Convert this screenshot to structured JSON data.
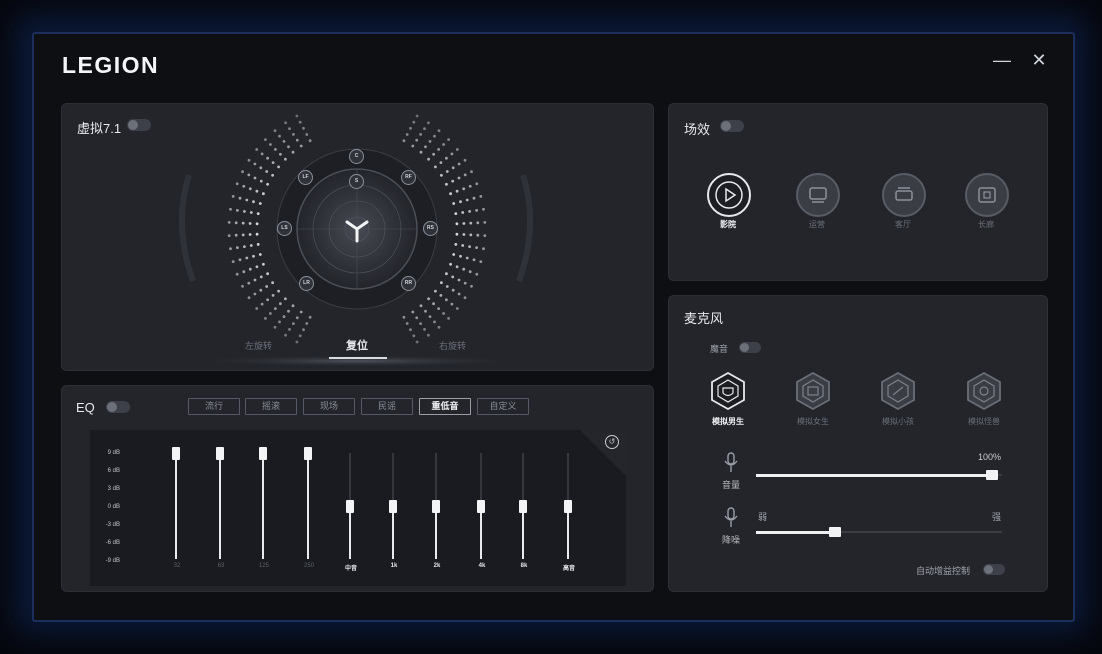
{
  "app": {
    "logo": "LEGION",
    "minimize": "—",
    "close": "✕"
  },
  "virtual71": {
    "title": "虚拟7.1",
    "speakers": [
      "C",
      "S",
      "LF",
      "RF",
      "LS",
      "RS",
      "LR",
      "RR"
    ],
    "controls": {
      "left": "左旋转",
      "center": "复位",
      "right": "右旋转"
    }
  },
  "scene": {
    "title": "场效",
    "modes": [
      {
        "label": "影院",
        "icon": "play-icon"
      },
      {
        "label": "运营",
        "icon": "theater-icon"
      },
      {
        "label": "客厅",
        "icon": "livingroom-icon"
      },
      {
        "label": "长廊",
        "icon": "corridor-icon"
      }
    ],
    "active_index": 0
  },
  "eq": {
    "title": "EQ",
    "presets": [
      "流行",
      "摇滚",
      "现场",
      "民谣",
      "重低音",
      "自定义"
    ],
    "active_preset": 4,
    "db_labels": [
      "9 dB",
      "6 dB",
      "3 dB",
      "0 dB",
      "-3 dB",
      "-6 dB",
      "-9 dB"
    ],
    "bands": [
      "32",
      "63",
      "125",
      "250",
      "中音",
      "1k",
      "2k",
      "4k",
      "8k",
      "高音"
    ],
    "band_values": [
      9,
      9,
      9,
      9,
      0,
      0,
      0,
      0,
      0,
      0
    ],
    "active_bands": [
      4,
      5,
      6,
      7,
      8,
      9
    ],
    "reset_icon": "reset-icon"
  },
  "mic": {
    "title": "麦克风",
    "voice_change_label": "魔音",
    "modes": [
      {
        "label": "模拟男生",
        "icon": "male-voice-icon"
      },
      {
        "label": "模拟女生",
        "icon": "female-voice-icon"
      },
      {
        "label": "模拟小孩",
        "icon": "child-voice-icon"
      },
      {
        "label": "模拟怪兽",
        "icon": "monster-voice-icon"
      }
    ],
    "active_index": 0,
    "volume": {
      "label": "音量",
      "value_text": "100%",
      "fraction": 0.96
    },
    "noise": {
      "label": "降噪",
      "low": "弱",
      "high": "强",
      "fraction": 0.32
    },
    "auto_gain_label": "自动增益控制"
  },
  "colors": {
    "accent": "#f0f2f5",
    "panel": "#23252b",
    "background": "#0e0f13",
    "glow": "#1b3a7a"
  }
}
